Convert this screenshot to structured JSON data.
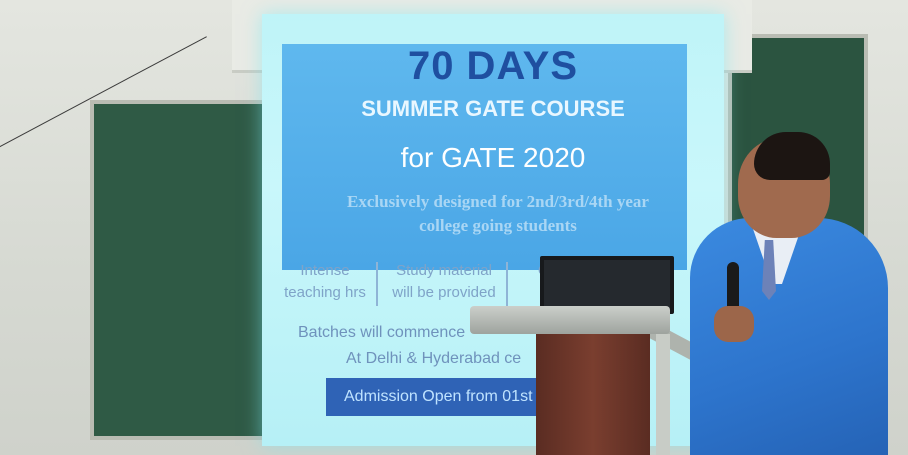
{
  "slide": {
    "days": "70 DAYS",
    "course": "SUMMER GATE COURSE",
    "gate": "for GATE 2020",
    "exclusive_line1": "Exclusively designed for 2nd/3rd/4th year",
    "exclusive_line2": "college going students",
    "features": [
      {
        "line1": "Intense",
        "line2": "teaching hrs"
      },
      {
        "line1": "Study material",
        "line2": "will be provided"
      },
      {
        "line1": "",
        "line2": "Cl"
      }
    ],
    "batches": "Batches will commence",
    "centers": "At Delhi & Hyderabad ce",
    "admission": "Admission Open from 01st Novem"
  }
}
